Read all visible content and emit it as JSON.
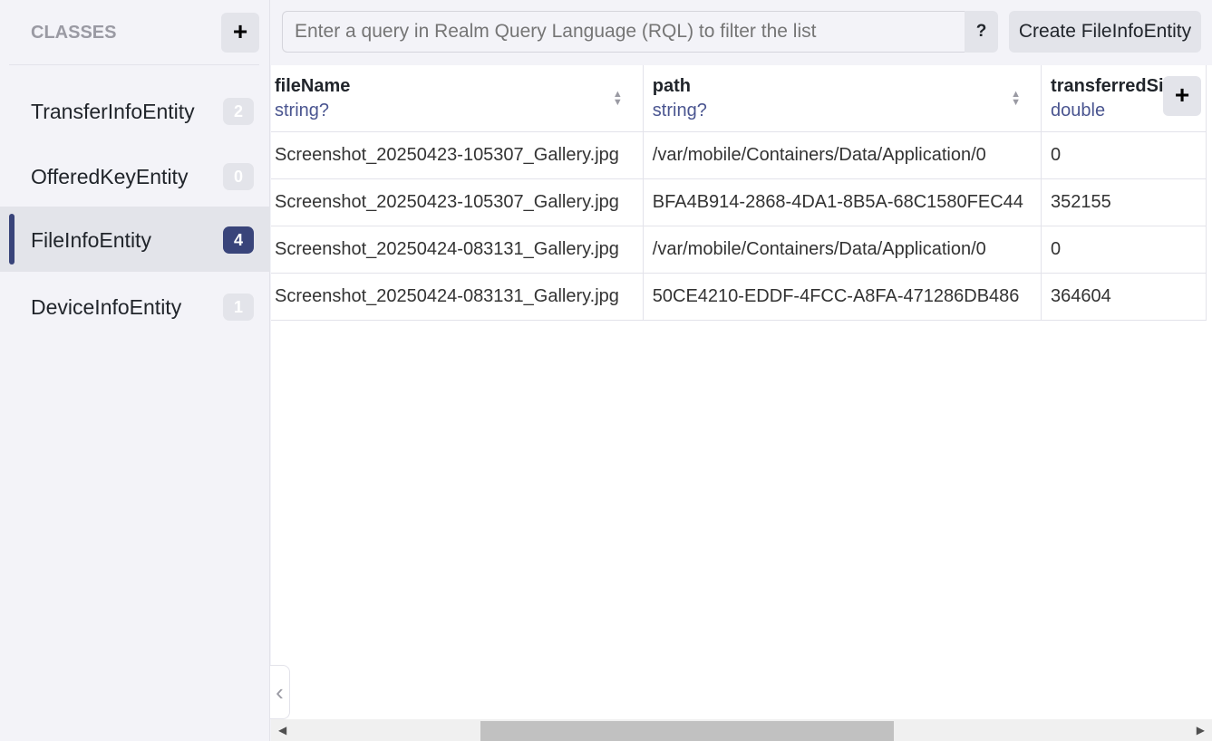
{
  "sidebar": {
    "title": "CLASSES",
    "add_icon": "plus-icon",
    "items": [
      {
        "label": "TransferInfoEntity",
        "count": "2",
        "active": false
      },
      {
        "label": "OfferedKeyEntity",
        "count": "0",
        "active": false
      },
      {
        "label": "FileInfoEntity",
        "count": "4",
        "active": true
      },
      {
        "label": "DeviceInfoEntity",
        "count": "1",
        "active": false
      }
    ]
  },
  "toolbar": {
    "search_placeholder": "Enter a query in Realm Query Language (RQL) to filter the list",
    "search_value": "",
    "help_label": "?",
    "create_label": "Create FileInfoEntity"
  },
  "table": {
    "columns": [
      {
        "name": "fileName",
        "type": "string?"
      },
      {
        "name": "path",
        "type": "string?"
      },
      {
        "name": "transferredSize",
        "type": "double"
      }
    ],
    "rows": [
      [
        "Screenshot_20250423-105307_Gallery.jpg",
        "/var/mobile/Containers/Data/Application/0",
        "0"
      ],
      [
        "Screenshot_20250423-105307_Gallery.jpg",
        "BFA4B914-2868-4DA1-8B5A-68C1580FEC44",
        "352155"
      ],
      [
        "Screenshot_20250424-083131_Gallery.jpg",
        "/var/mobile/Containers/Data/Application/0",
        "0"
      ],
      [
        "Screenshot_20250424-083131_Gallery.jpg",
        "50CE4210-EDDF-4FCC-A8FA-471286DB486",
        "364604"
      ]
    ]
  },
  "colors": {
    "accent": "#39447a",
    "type_text": "#4a5590"
  }
}
